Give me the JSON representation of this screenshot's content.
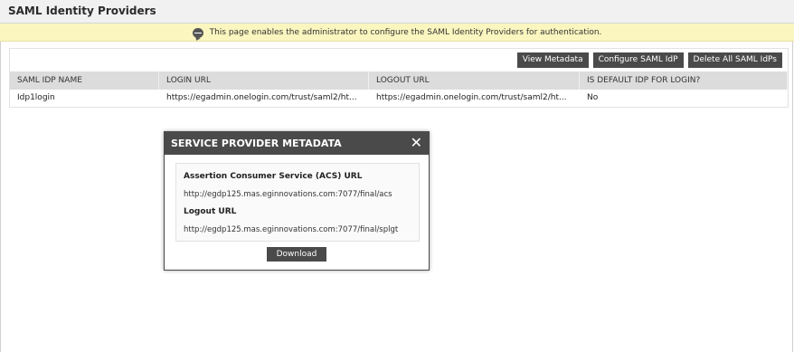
{
  "page": {
    "title": "SAML Identity Providers"
  },
  "banner": {
    "text": "This page enables the administrator to configure the SAML Identity Providers for authentication."
  },
  "toolbar": {
    "view_metadata": "View Metadata",
    "configure_saml_idp": "Configure SAML IdP",
    "delete_all": "Delete All SAML IdPs"
  },
  "table": {
    "columns": [
      "SAML IDP NAME",
      "LOGIN URL",
      "LOGOUT URL",
      "IS DEFAULT IDP FOR LOGIN?"
    ],
    "rows": [
      [
        "Idp1login",
        "https://egadmin.onelogin.com/trust/saml2/ht...",
        "https://egadmin.onelogin.com/trust/saml2/ht...",
        "No"
      ]
    ]
  },
  "modal": {
    "title": "SERVICE PROVIDER METADATA",
    "close_glyph": "✕",
    "acs_label": "Assertion Consumer Service (ACS) URL",
    "acs_url": "http://egdp125.mas.eginnovations.com:7077/final/acs",
    "logout_label": "Logout URL",
    "logout_url": "http://egdp125.mas.eginnovations.com:7077/final/splgt",
    "download_label": "Download"
  },
  "colors": {
    "banner_bg": "#fbf6bf",
    "button_bg": "#4a4a4a",
    "table_header_bg": "#dcdcdc"
  },
  "icons": {
    "banner": "speech-bubble-icon",
    "close": "close-icon"
  }
}
